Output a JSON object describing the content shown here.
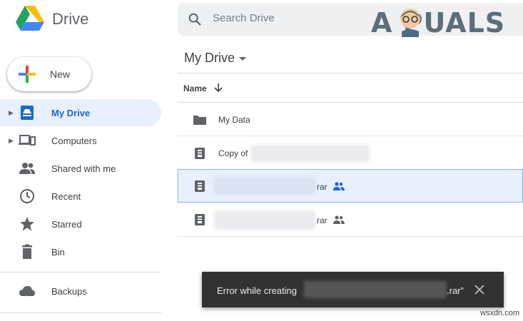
{
  "header": {
    "brand": "Drive",
    "search_placeholder": "Search Drive",
    "watermark_logo": "A  PUALS"
  },
  "new_button": {
    "label": "New"
  },
  "sidebar": {
    "items": [
      {
        "label": "My Drive",
        "icon": "my-drive-icon",
        "active": true,
        "expandable": true
      },
      {
        "label": "Computers",
        "icon": "computers-icon",
        "expandable": true
      },
      {
        "label": "Shared with me",
        "icon": "shared-with-me-icon"
      },
      {
        "label": "Recent",
        "icon": "clock-icon"
      },
      {
        "label": "Starred",
        "icon": "star-icon"
      },
      {
        "label": "Bin",
        "icon": "trash-icon"
      },
      {
        "label": "Backups",
        "icon": "cloud-icon"
      }
    ]
  },
  "main": {
    "breadcrumb": "My Drive",
    "column_header": "Name",
    "files": [
      {
        "name": "My Data",
        "type": "folder"
      },
      {
        "name": "Copy of",
        "type": "archive"
      },
      {
        "name": "rar",
        "type": "archive",
        "shared": true,
        "selected": true
      },
      {
        "name": "rar",
        "type": "archive",
        "shared": true
      }
    ]
  },
  "snackbar": {
    "text": "Error while creating",
    "suffix": ".rar”"
  },
  "footer": {
    "watermark": "wsxdn.com"
  },
  "colors": {
    "accent": "#1967d2",
    "selected_bg": "#e8f0fe",
    "snackbar_bg": "#323232"
  }
}
